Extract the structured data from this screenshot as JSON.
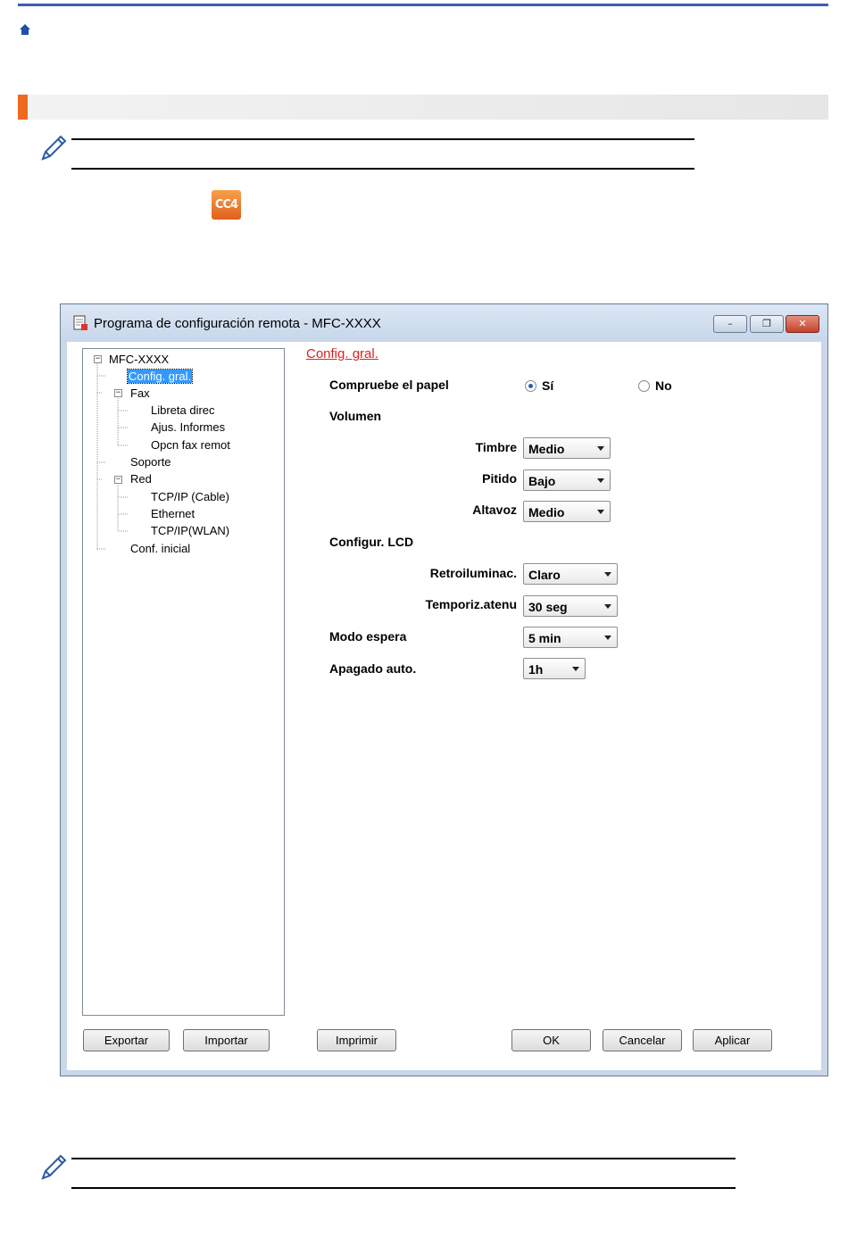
{
  "colors": {
    "accent": "#ee6a1f",
    "header_rule": "#3a5fb0",
    "selection": "#3399ff",
    "panel_title": "#e02020"
  },
  "icons": {
    "home": "home-icon",
    "note": "pencil-icon",
    "cc4": "cc4-icon"
  },
  "cc4_label": "CC4",
  "window": {
    "title": "Programa de configuración remota - MFC-XXXX",
    "controls": {
      "minimize": "–",
      "restore": "❐",
      "close": "✕"
    }
  },
  "tree": {
    "root": "MFC-XXXX",
    "items": [
      {
        "label": "Config. gral."
      },
      {
        "label": "Fax"
      },
      {
        "label": "Libreta direc"
      },
      {
        "label": "Ajus. Informes"
      },
      {
        "label": "Opcn fax remot"
      },
      {
        "label": "Soporte"
      },
      {
        "label": "Red"
      },
      {
        "label": "TCP/IP (Cable)"
      },
      {
        "label": "Ethernet"
      },
      {
        "label": "TCP/IP(WLAN)"
      },
      {
        "label": "Conf. inicial"
      }
    ]
  },
  "panel": {
    "title": "Config. gral.",
    "check_paper": {
      "label": "Compruebe  el papel",
      "yes": "Sí",
      "no": "No",
      "selected": "Sí"
    },
    "volume": {
      "heading": "Volumen",
      "ring": {
        "label": "Timbre",
        "value": "Medio"
      },
      "beep": {
        "label": "Pitido",
        "value": "Bajo"
      },
      "speaker": {
        "label": "Altavoz",
        "value": "Medio"
      }
    },
    "lcd": {
      "heading": "Configur. LCD",
      "backlight": {
        "label": "Retroiluminac.",
        "value": "Claro"
      },
      "dim_timer": {
        "label": "Temporiz.atenu",
        "value": "30 seg"
      }
    },
    "sleep": {
      "label": "Modo espera",
      "value": "5 min"
    },
    "auto_off": {
      "label": "Apagado auto.",
      "value": "1h"
    }
  },
  "buttons": {
    "export": "Exportar",
    "import": "Importar",
    "print": "Imprimir",
    "ok": "OK",
    "cancel": "Cancelar",
    "apply": "Aplicar"
  }
}
